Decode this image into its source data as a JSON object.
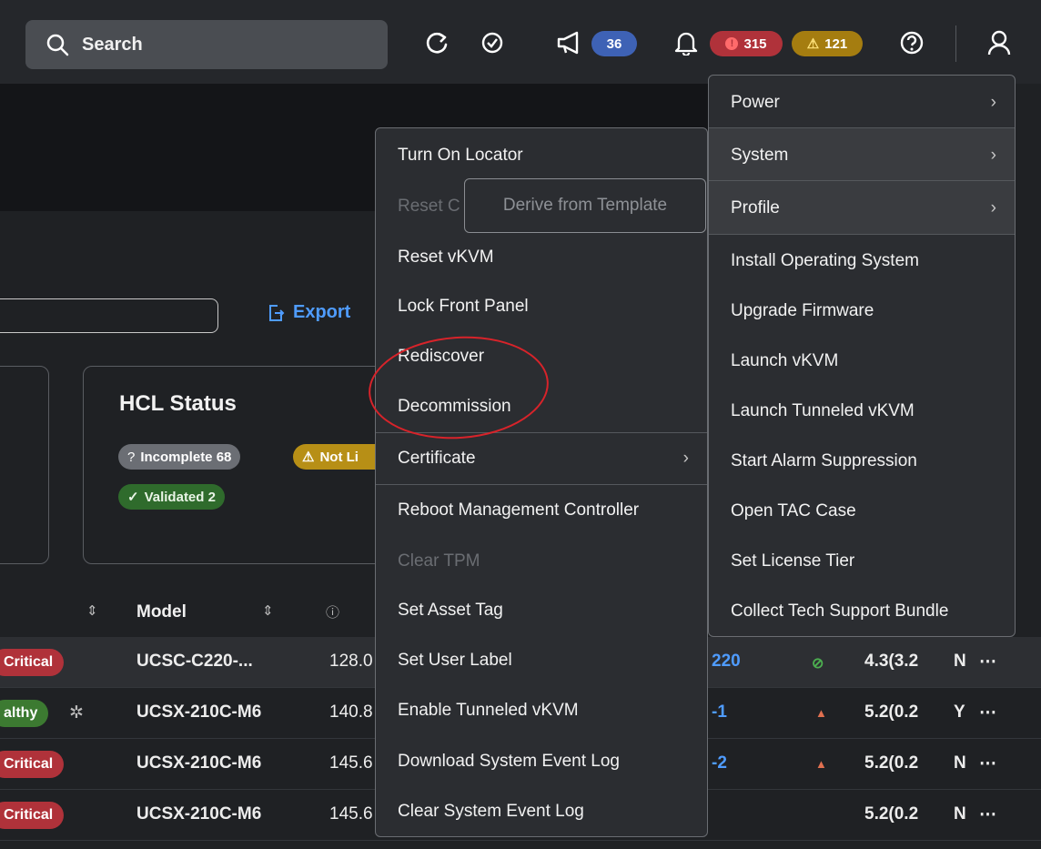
{
  "topbar": {
    "search_label": "Search",
    "announcements_count": "36",
    "critical_count": "315",
    "warning_count": "121"
  },
  "toolbar": {
    "export_label": "Export"
  },
  "hcl": {
    "title": "HCL Status",
    "incomplete": "Incomplete 68",
    "not_listed": "Not Li",
    "validated": "Validated 2"
  },
  "table": {
    "headers": {
      "model": "Model"
    },
    "rows": [
      {
        "status": "Critical",
        "status_kind": "critical",
        "model": "UCSC-C220-...",
        "memory": "128.0",
        "name": "220",
        "hcl_icon": "check-circle-icon",
        "firmware": "4.3(3.2",
        "flag": "N"
      },
      {
        "status": "althy",
        "status_kind": "healthy",
        "model": "UCSX-210C-M6",
        "memory": "140.8",
        "name": "-1",
        "hcl_icon": "warning-icon",
        "firmware": "5.2(0.2",
        "flag": "Y"
      },
      {
        "status": "Critical",
        "status_kind": "critical",
        "model": "UCSX-210C-M6",
        "memory": "145.6",
        "name": "-2",
        "hcl_icon": "warning-icon",
        "firmware": "5.2(0.2",
        "flag": "N"
      },
      {
        "status": "Critical",
        "status_kind": "critical",
        "model": "UCSX-210C-M6",
        "memory": "145.6",
        "name": "",
        "hcl_icon": "",
        "firmware": "5.2(0.2",
        "flag": "N"
      }
    ]
  },
  "menu_main": {
    "items": [
      {
        "label": "Power",
        "submenu": true
      },
      {
        "label": "System",
        "submenu": true
      },
      {
        "label": "Profile",
        "submenu": true
      },
      {
        "label": "Install Operating System"
      },
      {
        "label": "Upgrade Firmware"
      },
      {
        "label": "Launch vKVM"
      },
      {
        "label": "Launch Tunneled vKVM"
      },
      {
        "label": "Start Alarm Suppression"
      },
      {
        "label": "Open TAC Case"
      },
      {
        "label": "Set License Tier"
      },
      {
        "label": "Collect Tech Support Bundle"
      }
    ]
  },
  "menu_system": {
    "items": [
      {
        "label": "Turn On Locator"
      },
      {
        "label": "Reset C",
        "disabled": true
      },
      {
        "label": "Reset vKVM"
      },
      {
        "label": "Lock Front Panel"
      },
      {
        "label": "Rediscover"
      },
      {
        "label": "Decommission"
      },
      {
        "label": "Certificate",
        "submenu": true
      },
      {
        "label": "Reboot Management Controller"
      },
      {
        "label": "Clear TPM",
        "disabled": true
      },
      {
        "label": "Set Asset Tag"
      },
      {
        "label": "Set User Label"
      },
      {
        "label": "Enable Tunneled vKVM"
      },
      {
        "label": "Download System Event Log"
      },
      {
        "label": "Clear System Event Log"
      }
    ]
  },
  "tooltip": {
    "text": "Derive from Template"
  },
  "colors": {
    "accent": "#4f9cff",
    "critical": "#b0323a",
    "healthy": "#3c7a31",
    "warning": "#b78f16",
    "annotation": "#d8232a"
  }
}
